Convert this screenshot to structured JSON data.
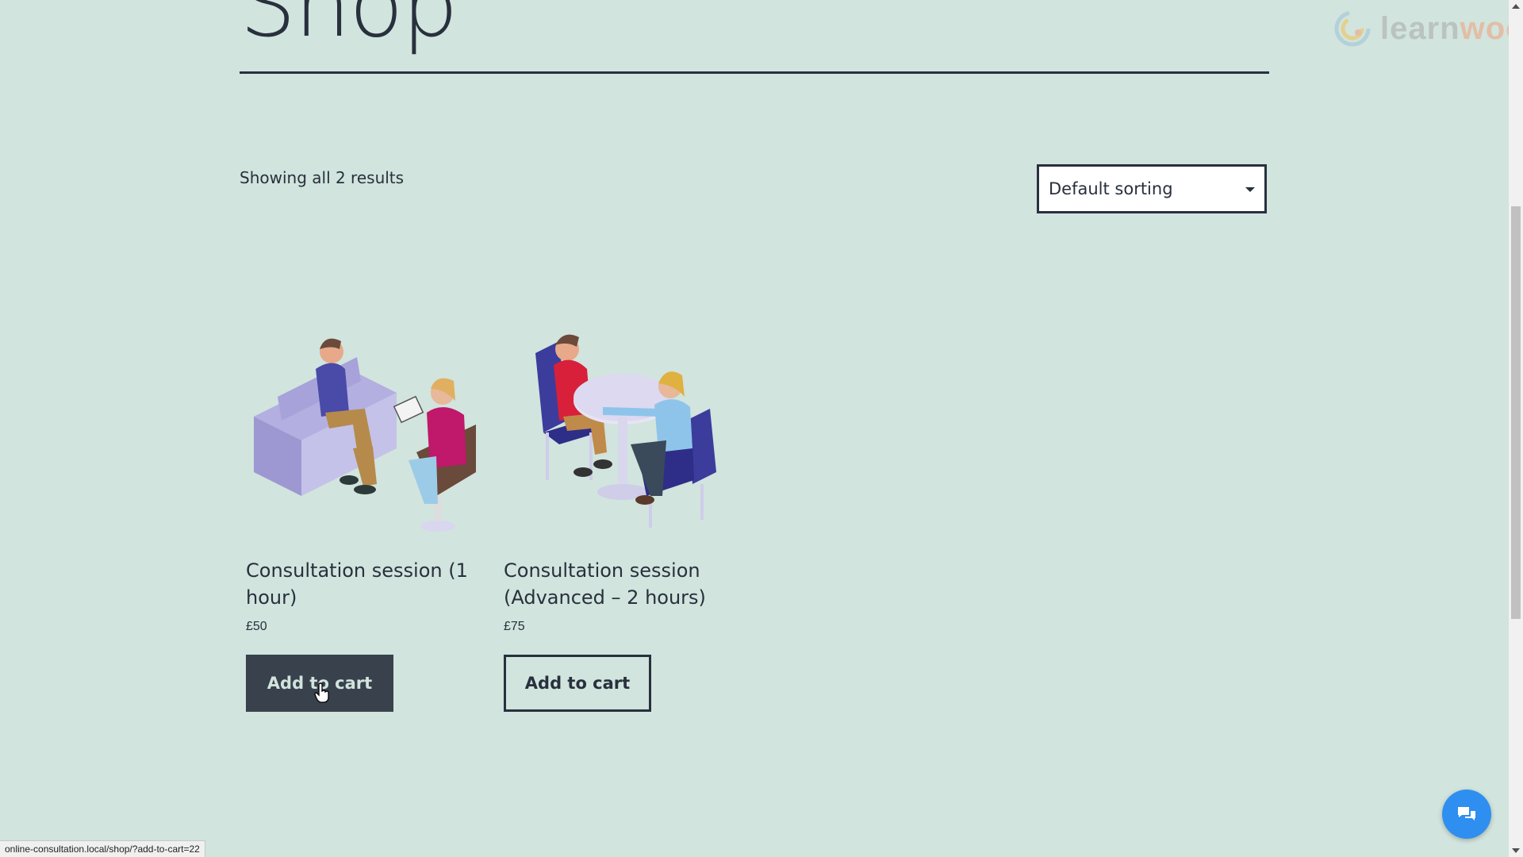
{
  "page": {
    "title": "Shop"
  },
  "watermark": {
    "text_part1": "learn",
    "text_part2": "woo"
  },
  "shop": {
    "result_count": "Showing all 2 results",
    "ordering": {
      "selected": "Default sorting"
    }
  },
  "products": [
    {
      "name": "Consultation session (1 hour)",
      "price": "£50",
      "button": "Add to cart",
      "image_icon": "therapy-couch-illustration"
    },
    {
      "name": "Consultation session (Advanced – 2 hours)",
      "price": "£75",
      "button": "Add to cart",
      "image_icon": "table-meeting-illustration"
    }
  ],
  "status_bar": {
    "url": "online-consultation.local/shop/?add-to-cart=22"
  },
  "chat": {
    "icon": "chat-bubbles-icon"
  },
  "colors": {
    "background": "#d1e4dd",
    "text": "#28303d",
    "button_dark": "#39414d",
    "chat": "#2e8ff0"
  }
}
